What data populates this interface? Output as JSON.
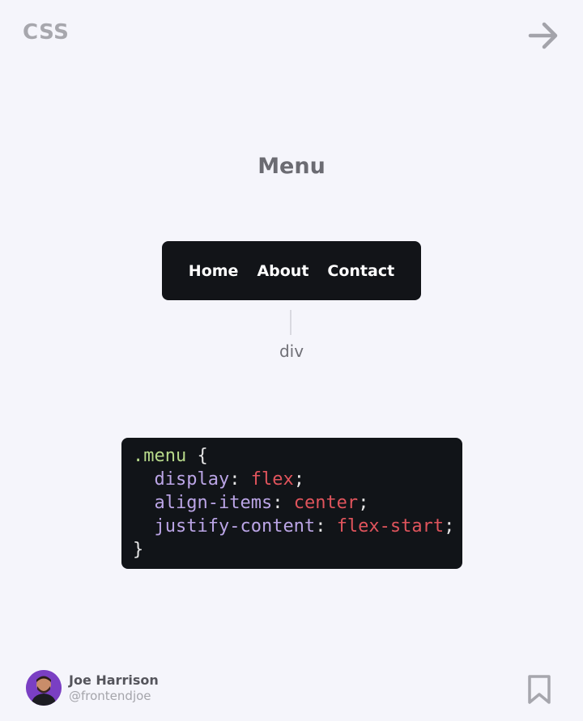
{
  "header": {
    "tag": "CSS",
    "next_icon": "arrow-right-icon"
  },
  "title": "Menu",
  "demo_menu": {
    "items": [
      "Home",
      "About",
      "Contact"
    ],
    "annotation": "div"
  },
  "code": {
    "selector": ".menu",
    "open_brace": "{",
    "close_brace": "}",
    "declarations": [
      {
        "property": "display",
        "value": "flex"
      },
      {
        "property": "align-items",
        "value": "center"
      },
      {
        "property": "justify-content",
        "value": "flex-start"
      }
    ]
  },
  "author": {
    "name": "Joe Harrison",
    "handle": "@frontendjoe"
  },
  "footer": {
    "bookmark_icon": "bookmark-icon"
  },
  "colors": {
    "background": "#f5f5fb",
    "dark_panel": "#121418",
    "code_selector": "#b7d98a",
    "code_property": "#bba5e6",
    "code_value": "#e0545c",
    "avatar_bg": "#7a3fc3"
  }
}
